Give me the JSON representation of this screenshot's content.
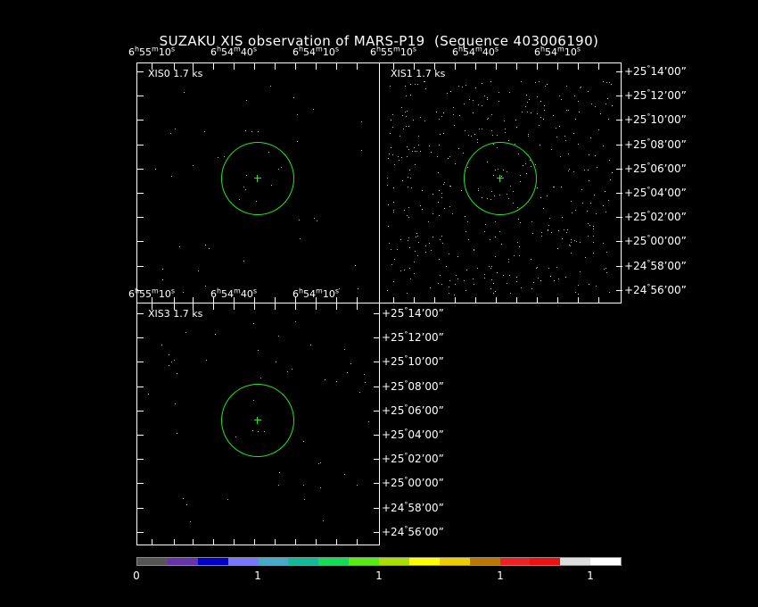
{
  "title": "SUZAKU XIS observation of MARS-P19  (Sequence 403006190)",
  "panels": {
    "xis0": {
      "label": "XIS0 1.7 ks"
    },
    "xis1": {
      "label": "XIS1 1.7 ks"
    },
    "xis3": {
      "label": "XIS3 1.7 ks"
    }
  },
  "ra_top": [
    {
      "h": "6",
      "m": "55",
      "s": "10",
      "sunit": "s"
    },
    {
      "h": "6",
      "m": "54",
      "s": "40",
      "sunit": "s"
    },
    {
      "h": "6",
      "m": "54",
      "s": "10",
      "sunit": "s"
    },
    {
      "h": "6",
      "m": "55",
      "s": "10",
      "sunit": "s"
    },
    {
      "h": "6",
      "m": "54",
      "s": "40",
      "sunit": "s"
    },
    {
      "h": "6",
      "m": "54",
      "s": "10",
      "sunit": "s"
    }
  ],
  "ra_mid": [
    {
      "h": "6",
      "m": "55",
      "s": "10",
      "sunit": "s"
    },
    {
      "h": "6",
      "m": "54",
      "s": "40",
      "sunit": "s"
    },
    {
      "h": "6",
      "m": "54",
      "s": "10",
      "sunit": "s"
    }
  ],
  "dec_labels": [
    {
      "d": "+25",
      "m": "14",
      "s": "00"
    },
    {
      "d": "+25",
      "m": "12",
      "s": "00"
    },
    {
      "d": "+25",
      "m": "10",
      "s": "00"
    },
    {
      "d": "+25",
      "m": "08",
      "s": "00"
    },
    {
      "d": "+25",
      "m": "06",
      "s": "00"
    },
    {
      "d": "+25",
      "m": "04",
      "s": "00"
    },
    {
      "d": "+25",
      "m": "02",
      "s": "00"
    },
    {
      "d": "+25",
      "m": "00",
      "s": "00"
    },
    {
      "d": "+24",
      "m": "58",
      "s": "00"
    },
    {
      "d": "+24",
      "m": "56",
      "s": "00"
    }
  ],
  "colorbar": {
    "colors": [
      "#555555",
      "#6633aa",
      "#0000cc",
      "#7777ff",
      "#44aacc",
      "#11bb99",
      "#11dd55",
      "#55ee11",
      "#aadd00",
      "#ffff00",
      "#eecc00",
      "#bb7700",
      "#ee2222",
      "#ee1111",
      "#dddddd",
      "#ffffff"
    ],
    "labels": [
      "0",
      "1",
      "1",
      "1",
      "1"
    ]
  }
}
